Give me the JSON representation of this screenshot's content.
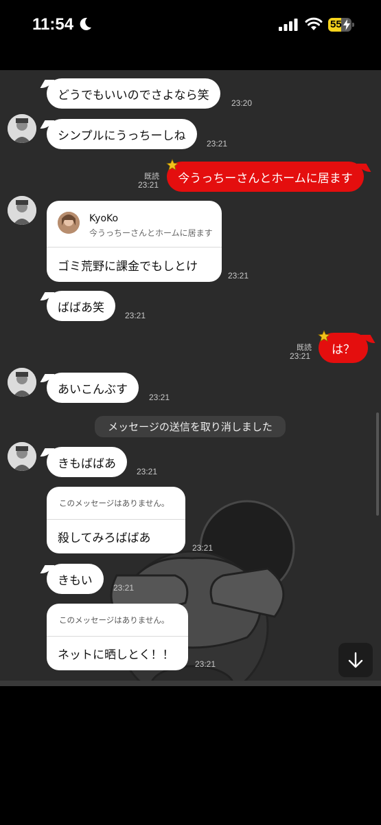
{
  "status_bar": {
    "time": "11:54",
    "battery_percent": "55",
    "battery_level": 0.55,
    "icons": [
      "moon-icon",
      "signal-icon",
      "wifi-icon",
      "battery-icon"
    ]
  },
  "colors": {
    "chat_background": "#2b2b2b",
    "sent_bubble": "#e40e0e",
    "received_bubble": "#ffffff",
    "battery": "#f5d21c"
  },
  "messages": [
    {
      "id": "m1",
      "side": "left",
      "text": "どうでもいいのでさよなら笑",
      "time": "23:20"
    },
    {
      "id": "m2",
      "side": "left",
      "text": "シンプルにうっちーしね",
      "time": "23:21"
    },
    {
      "id": "m3",
      "side": "right",
      "text": "今うっちーさんとホームに居ます",
      "time": "23:21",
      "read": "既読"
    },
    {
      "id": "m4",
      "side": "left",
      "type": "reply",
      "reply_to": {
        "name": "KyoKo",
        "text": "今うっちーさんとホームに居ます"
      },
      "text": "ゴミ荒野に課金でもしとけ",
      "time": "23:21"
    },
    {
      "id": "m5",
      "side": "left",
      "text": "ばばあ笑",
      "time": "23:21"
    },
    {
      "id": "m6",
      "side": "right",
      "text": "は？",
      "time": "23:21",
      "read": "既読"
    },
    {
      "id": "m7",
      "side": "left",
      "text": "あいこんぶす",
      "time": "23:21"
    },
    {
      "id": "m8",
      "side": "system",
      "text": "メッセージの送信を取り消しました"
    },
    {
      "id": "m9",
      "side": "left",
      "text": "きもばばあ",
      "time": "23:21"
    },
    {
      "id": "m10",
      "side": "left",
      "type": "reply",
      "reply_note": "このメッセージはありません。",
      "text": "殺してみろばばあ",
      "time": "23:21"
    },
    {
      "id": "m11",
      "side": "left",
      "text": "きもい",
      "time": "23:21"
    },
    {
      "id": "m12",
      "side": "left",
      "type": "reply",
      "reply_note": "このメッセージはありません。",
      "text": "ネットに晒しとく！！",
      "time": "23:21"
    }
  ]
}
